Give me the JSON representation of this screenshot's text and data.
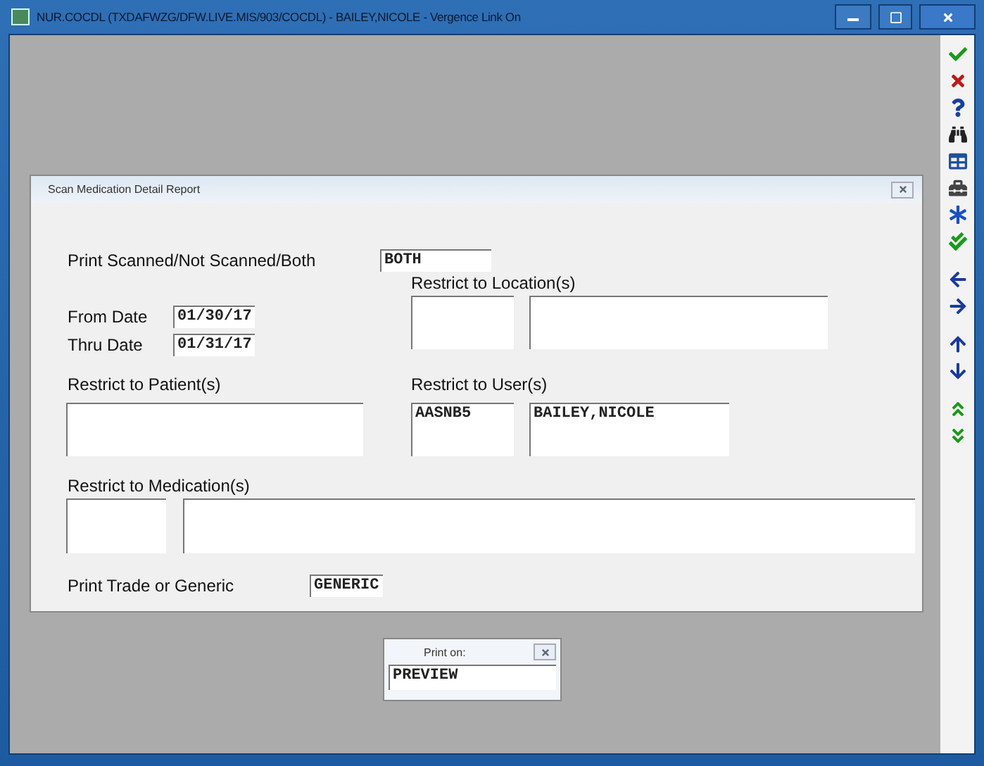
{
  "window": {
    "title": "NUR.COCDL (TXDAFWZG/DFW.LIVE.MIS/903/COCDL) - BAILEY,NICOLE - Vergence Link On"
  },
  "report_dialog": {
    "title": "Scan Medication Detail Report",
    "print_scanned": {
      "label": "Print Scanned/Not Scanned/Both",
      "value": "BOTH"
    },
    "from_date": {
      "label": "From Date",
      "value": "01/30/17"
    },
    "thru_date": {
      "label": "Thru Date",
      "value": "01/31/17"
    },
    "location": {
      "label": "Restrict to Location(s)"
    },
    "patient": {
      "label": "Restrict to Patient(s)"
    },
    "user": {
      "label": "Restrict to User(s)",
      "code": "AASNB5",
      "name": "BAILEY,NICOLE"
    },
    "medication": {
      "label": "Restrict to Medication(s)"
    },
    "trade_generic": {
      "label": "Print Trade or Generic",
      "value": "GENERIC"
    }
  },
  "print_dialog": {
    "title": "Print on:",
    "value": "PREVIEW"
  }
}
